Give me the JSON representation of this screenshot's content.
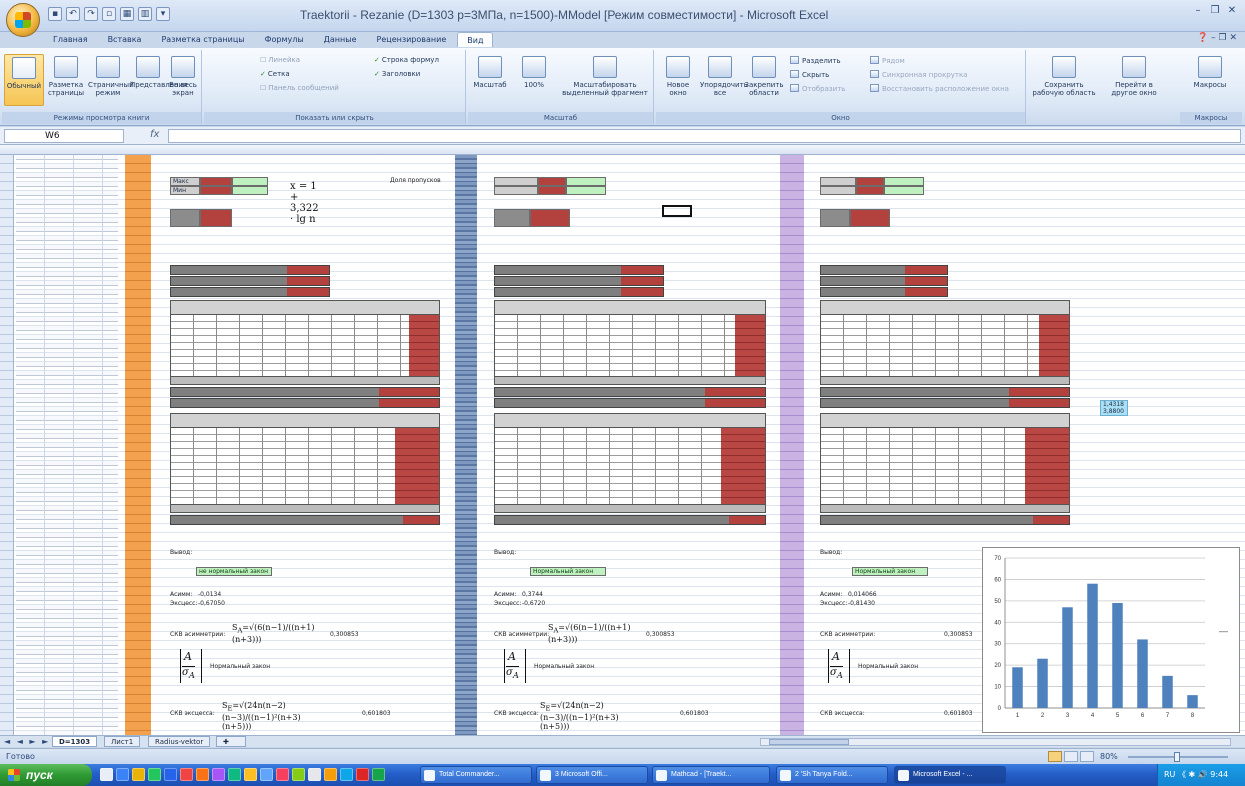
{
  "window": {
    "title": "Traektorii - Rezanie (D=1303 p=3МПа, n=1500)-MModel [Режим совместимости] - Microsoft Excel"
  },
  "ribbon": {
    "tabs": [
      "Главная",
      "Вставка",
      "Разметка страницы",
      "Формулы",
      "Данные",
      "Рецензирование",
      "Вид"
    ],
    "active_tab": "Вид",
    "groups": {
      "views": {
        "label": "Режимы просмотра книги",
        "normal": "Обычный",
        "page_layout": "Разметка страницы",
        "page_break": "Страничный режим",
        "custom_views": "Представления",
        "full_screen": "Во весь экран"
      },
      "show": {
        "label": "Показать или скрыть",
        "ruler": "Линейка",
        "gridlines": "Сетка",
        "messages": "Панель сообщений",
        "formula_bar": "Строка формул",
        "headings": "Заголовки"
      },
      "zoom": {
        "label": "Масштаб",
        "zoom": "Масштаб",
        "hundred": "100%",
        "to_selection": "Масштабировать выделенный фрагмент"
      },
      "window": {
        "label": "Окно",
        "new_window": "Новое окно",
        "arrange_all": "Упорядочить все",
        "freeze": "Закрепить области",
        "split": "Разделить",
        "hide": "Скрыть",
        "unhide": "Отобразить",
        "side_by_side": "Рядом",
        "sync_scroll": "Синхронная прокрутка",
        "reset_pos": "Восстановить расположение окна",
        "save_workspace": "Сохранить рабочую область",
        "switch_windows": "Перейти в другое окно"
      },
      "macros": {
        "label": "Макросы",
        "macros": "Макросы"
      }
    }
  },
  "formula_bar": {
    "name_box": "W6",
    "fx": "fx",
    "value": ""
  },
  "sheet": {
    "equation": "x = 1 + 3,322 · lg n",
    "panel_left": {
      "label_max": "Макс",
      "label_min": "Мин",
      "note_left": "Доля пропусков",
      "normality_label": "Вывод:",
      "normality_value": "не нормальный закон",
      "asym_label": "Асимм:",
      "asym_value": "-0,0134",
      "excess_label": "Эксцесс:",
      "excess_value": "-0,67050",
      "ckb_asym": "СКВ асимметрии:",
      "ckb_asym_value": "0,300853",
      "ckb_excess": "СКВ эксцесса:",
      "ckb_excess_value": "0,601803",
      "normal_law": "Нормальный закон"
    },
    "panel_mid": {
      "normality_value": "Нормальный закон",
      "asym_value": "0,3744",
      "excess_value": "-0,6720",
      "ckb_asym_value": "0,300853",
      "ckb_excess_value": "0,601803",
      "normal_law": "Нормальный закон"
    },
    "panel_right": {
      "normality_value": "Нормальный закон",
      "asym_value": "0,014066",
      "excess_value": "-0,81430",
      "ckb_asym_value": "0,300853",
      "ckb_excess_value": "0,601803",
      "normal_law": "Нормальный закон"
    },
    "side_values": [
      "1,4318",
      "3,8800"
    ]
  },
  "chart_data": {
    "type": "bar",
    "categories": [
      "1",
      "2",
      "3",
      "4",
      "5",
      "6",
      "7",
      "8"
    ],
    "values": [
      19,
      23,
      47,
      58,
      49,
      32,
      15,
      6
    ],
    "ylim": [
      0,
      70
    ],
    "yticks": [
      "0",
      "10",
      "20",
      "30",
      "40",
      "50",
      "60",
      "70"
    ],
    "color": "#4f81bd",
    "legend_marker": "—",
    "grid": true
  },
  "sheet_tabs": {
    "nav": "◄ ◄ ► ►",
    "tabs": [
      "D=1303",
      "Лист1",
      "Radius-vektor"
    ],
    "active": "D=1303"
  },
  "status": {
    "ready": "Готово",
    "zoom": "80%"
  },
  "taskbar": {
    "start": "пуск",
    "buttons": [
      "Total Commander...",
      "3 Microsoft Offi...",
      "Mathcad - [Traekt...",
      "2 'Sh Tanya Fold...",
      "Microsoft Excel - ..."
    ],
    "active_button": 4,
    "clock": "RU 《 ✱ 🔊 9:44"
  }
}
